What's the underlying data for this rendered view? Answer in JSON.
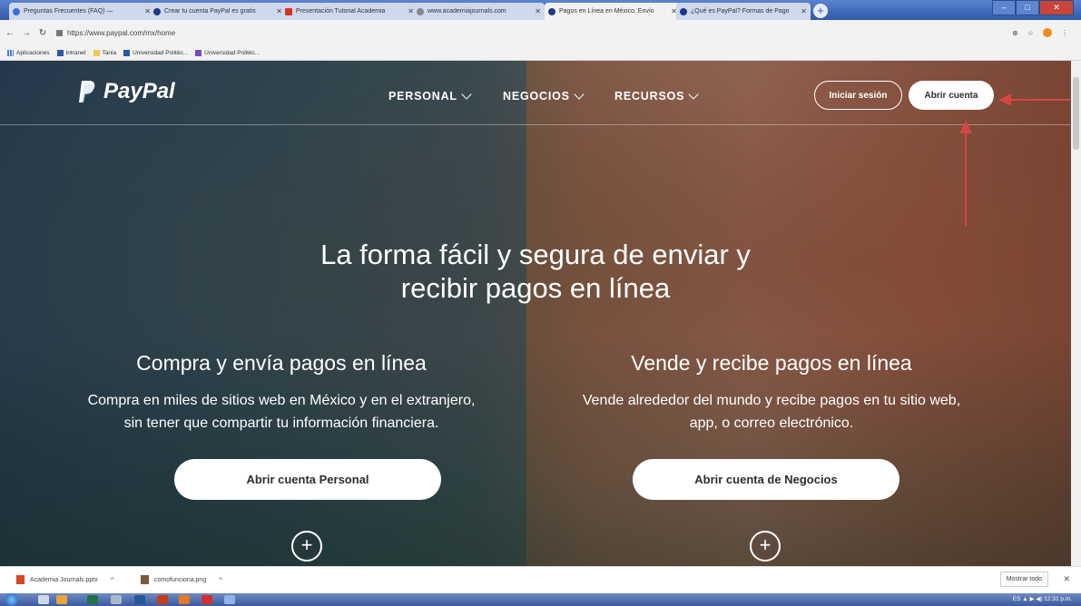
{
  "browser": {
    "tabs": [
      {
        "title": "Preguntas Frecuentes (FAQ) — ",
        "active": false
      },
      {
        "title": "Crear tu cuenta PayPal es gratis",
        "active": false
      },
      {
        "title": "Presentación Tutorial Academia",
        "active": false
      },
      {
        "title": "www.academiajournals.com",
        "active": false
      },
      {
        "title": "Pagos en Línea en México, Envío",
        "active": true
      },
      {
        "title": "¿Qué es PayPal? Formas de Pago",
        "active": false
      }
    ],
    "new_tab_label": "+",
    "url": "https://www.paypal.com/mx/home",
    "bookmarks": [
      {
        "label": "Aplicaciones",
        "icon": "apps-grid-icon"
      },
      {
        "label": "Intranet",
        "icon": "intranet-icon"
      },
      {
        "label": "Tania",
        "icon": "folder-icon"
      },
      {
        "label": "Universidad Politéc...",
        "icon": "intranet-icon"
      },
      {
        "label": "Universidad Politéc...",
        "icon": "university-icon"
      }
    ]
  },
  "header": {
    "logo_text": "PayPal",
    "nav": [
      {
        "label": "PERSONAL"
      },
      {
        "label": "NEGOCIOS"
      },
      {
        "label": "RECURSOS"
      }
    ],
    "login_label": "Iniciar sesión",
    "signup_label": "Abrir cuenta"
  },
  "hero": {
    "headline_line1": "La forma fácil y segura de enviar y",
    "headline_line2": "recibir pagos en línea",
    "personal": {
      "title": "Compra y envía pagos en línea",
      "text_line1": "Compra en miles de sitios web en México y en el extranjero,",
      "text_line2": "sin tener que compartir tu información financiera.",
      "cta": "Abrir cuenta Personal"
    },
    "business": {
      "title": "Vende y recibe pagos en línea",
      "text_line1": "Vende alrededor del mundo y recibe pagos en tu sitio web,",
      "text_line2": "app, o correo electrónico.",
      "cta": "Abrir cuenta de Negocios"
    },
    "expand_symbol": "+"
  },
  "downloads": {
    "items": [
      {
        "name": "Academia Journals.pptx"
      },
      {
        "name": "comofunciona.png"
      }
    ],
    "show_all_label": "Mostrar todo",
    "close_symbol": "✕"
  },
  "taskbar": {
    "tray_text": "ES  ▲  ▶  ◀)  12:31 p.m."
  },
  "colors": {
    "annotation_arrow": "#d64545",
    "paypal_navy": "#003087",
    "chrome_blue": "#2f5aa8"
  }
}
